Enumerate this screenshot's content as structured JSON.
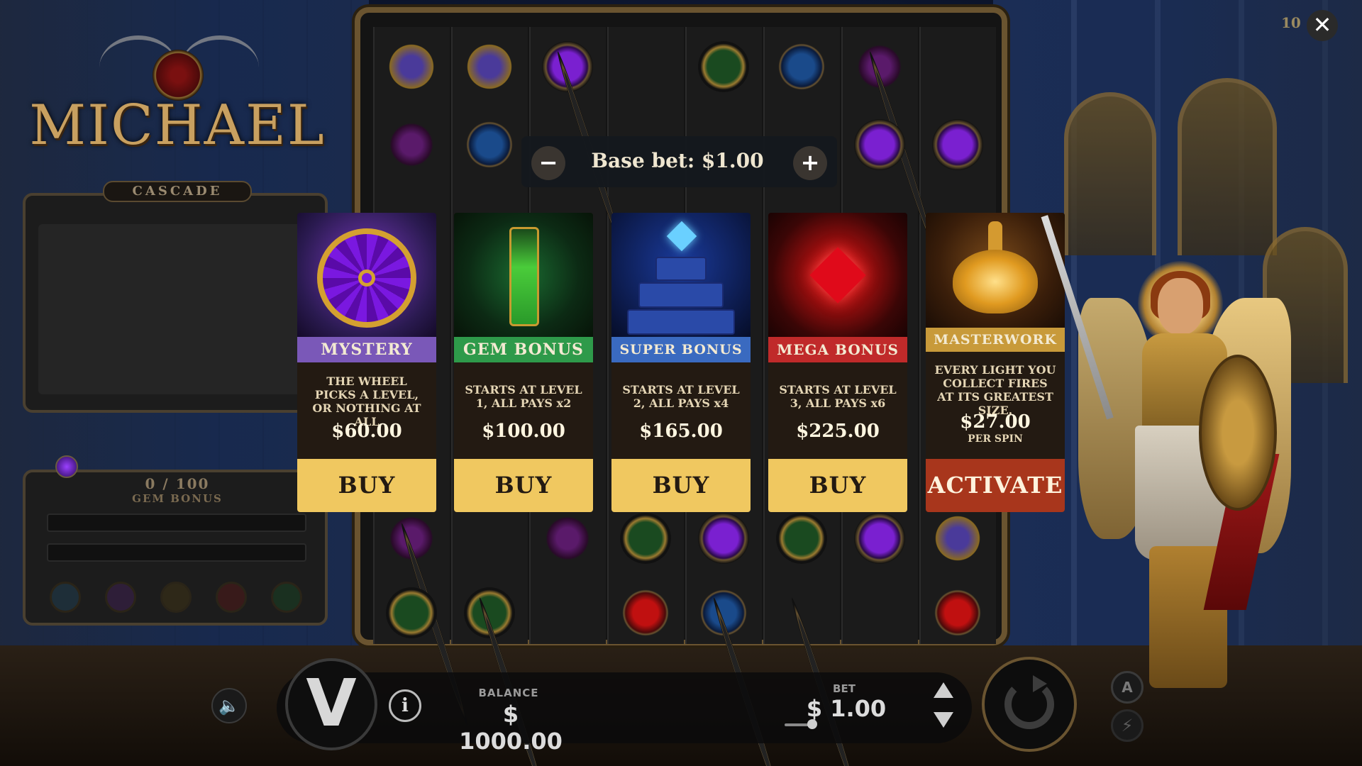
{
  "game": {
    "title": "MICHAEL",
    "corner_number": "10"
  },
  "cascade": {
    "label": "CASCADE"
  },
  "gem_bonus_meter": {
    "count": "0 / 100",
    "label": "GEM BONUS",
    "progress": 0
  },
  "base_bet": {
    "text": "Base bet: $1.00",
    "minus": "−",
    "plus": "+"
  },
  "cards": [
    {
      "title": "MYSTERY",
      "description": "THE WHEEL PICKS A LEVEL, OR NOTHING AT ALL",
      "price": "$60.00",
      "button": "BUY",
      "band_color": "#7a58b8"
    },
    {
      "title": "GEM BONUS",
      "description": "STARTS AT LEVEL 1, ALL PAYS x2",
      "price": "$100.00",
      "button": "BUY",
      "band_color": "#2e9a4a"
    },
    {
      "title": "SUPER BONUS",
      "description": "STARTS AT LEVEL 2, ALL PAYS x4",
      "price": "$165.00",
      "button": "BUY",
      "band_color": "#3a6ac0"
    },
    {
      "title": "MEGA BONUS",
      "description": "STARTS AT LEVEL 3, ALL PAYS x6",
      "price": "$225.00",
      "button": "BUY",
      "band_color": "#c02a2a"
    },
    {
      "title": "MASTERWORK",
      "description": "EVERY LIGHT YOU COLLECT FIRES AT ITS GREATEST SIZE.",
      "price": "$27.00",
      "price_sub": "PER SPIN",
      "button": "ACTIVATE",
      "band_color": "#c89a3a"
    }
  ],
  "bottom_bar": {
    "logo": "V",
    "info": "i",
    "balance_label": "BALANCE",
    "balance_value": "$ 1000.00",
    "bet_label": "BET",
    "bet_value": "$ 1.00",
    "auto_label": "A",
    "turbo_icon": "⚡",
    "sound_icon": "🔈"
  },
  "close": "✕",
  "colors": {
    "buy_button": "#f0c860",
    "activate_button": "#a8361c",
    "frame_gold": "#6a5430"
  }
}
